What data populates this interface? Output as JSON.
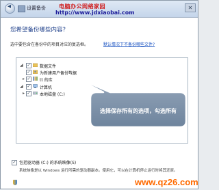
{
  "titlebar": {
    "title": "设置备份",
    "watermark_top": "电脑办公网络家园",
    "watermark_url": "http://www.jdxiaobai.com",
    "close_label": "✕"
  },
  "main": {
    "heading": "您希望备份哪些内容?",
    "description": "选中要包含在备份中的项目对应的复选框。",
    "help_link": "默认情况下不备份哪些文件?"
  },
  "tree": {
    "items": [
      {
        "label": "数据文件",
        "checked": true,
        "icon": "folder-icon"
      },
      {
        "label": "为新建用户备份数据",
        "checked": true,
        "icon": "user-folder-icon"
      },
      {
        "label": "tt 的库",
        "checked": true,
        "icon": "library-icon"
      },
      {
        "label": "计算机",
        "checked": true,
        "icon": "computer-icon"
      },
      {
        "label": "本地磁盘 (C:)",
        "checked": true,
        "icon": "drive-icon"
      }
    ]
  },
  "callout": {
    "text": "选择保存所有的选项，勾选所有"
  },
  "bottom": {
    "include_label": "包括驱动器 (C:) 的系统映像(S)",
    "note": "系统映像是以 Windows 运行所需的驱动器副本。使用它，可以在计算机停止运行时将其还原。"
  },
  "footer": {
    "url": "www.qz26.com"
  },
  "colors": {
    "heading": "#1e3f8a",
    "link": "#1b54c2",
    "callout_fill": "#7f95ad",
    "watermark_red": "#d02020",
    "footer_orange": "#ff6a00"
  }
}
